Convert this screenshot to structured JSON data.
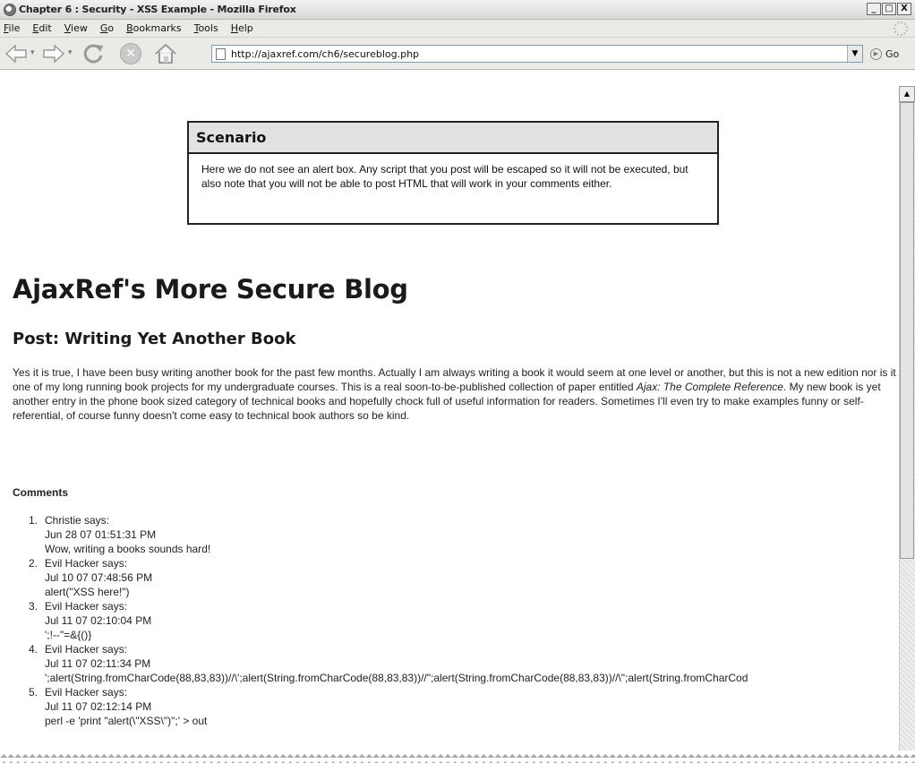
{
  "window": {
    "title": "Chapter 6 : Security - XSS Example - Mozilla Firefox",
    "buttons": [
      "_",
      "□",
      "X"
    ]
  },
  "menu": [
    {
      "u": "F",
      "rest": "ile"
    },
    {
      "u": "E",
      "rest": "dit"
    },
    {
      "u": "V",
      "rest": "iew"
    },
    {
      "u": "G",
      "rest": "o"
    },
    {
      "u": "B",
      "rest": "ookmarks"
    },
    {
      "u": "T",
      "rest": "ools"
    },
    {
      "u": "H",
      "rest": "elp"
    }
  ],
  "toolbar": {
    "url": "http://ajaxref.com/ch6/secureblog.php",
    "go_label": "Go"
  },
  "scenario": {
    "heading": "Scenario",
    "text": "Here we do not see an alert box. Any script that you post will be escaped so it will not be executed, but also note that you will not be able to post HTML that will work in your comments either."
  },
  "blog": {
    "title": "AjaxRef's More Secure Blog",
    "post_title": "Post: Writing Yet Another Book",
    "post_before": "Yes it is true, I have been busy writing another book for the past few months. Actually I am always writing a book it would seem at one level or another, but this is not a new edition nor is it one of my long running book projects for my undergraduate courses. This is a real soon-to-be-published collection of paper entitled ",
    "post_italic": "Ajax: The Complete Reference",
    "post_after": ". My new book is yet another entry in the phone book sized category of technical books and hopefully chock full of useful information for readers. Sometimes I'll even try to make examples funny or self-referential, of course funny doesn't come easy to technical book authors so be kind.",
    "comments_heading": "Comments"
  },
  "comments": [
    {
      "num": "1.",
      "author": "Christie says:",
      "date": "Jun 28 07 01:51:31 PM",
      "text": "Wow, writing a books sounds hard!"
    },
    {
      "num": "2.",
      "author": "Evil Hacker says:",
      "date": "Jul 10 07 07:48:56 PM",
      "text": "alert(\"XSS here!\")"
    },
    {
      "num": "3.",
      "author": "Evil Hacker says:",
      "date": "Jul 11 07 02:10:04 PM",
      "text": "';!--\"=&{()}"
    },
    {
      "num": "4.",
      "author": "Evil Hacker says:",
      "date": "Jul 11 07 02:11:34 PM",
      "text": "';alert(String.fromCharCode(88,83,83))//\\';alert(String.fromCharCode(88,83,83))//\";alert(String.fromCharCode(88,83,83))//\\\";alert(String.fromCharCod"
    },
    {
      "num": "5.",
      "author": "Evil Hacker says:",
      "date": "Jul 11 07 02:12:14 PM",
      "text": "perl -e 'print \"alert(\\\"XSS\\\")\";' > out"
    }
  ]
}
